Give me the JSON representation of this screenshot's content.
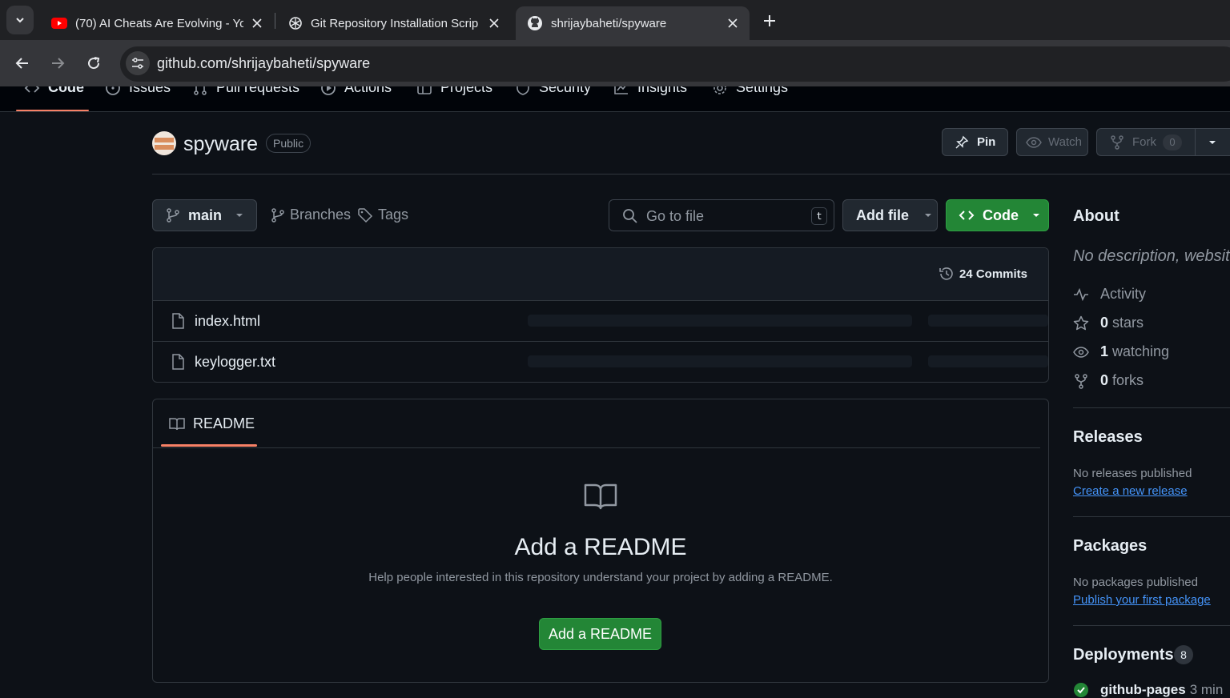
{
  "browser": {
    "tabs": [
      {
        "title": "(70) AI Cheats Are Evolving - Yo",
        "icon": "youtube-icon",
        "active": false
      },
      {
        "title": "Git Repository Installation Scrip",
        "icon": "chatgpt-icon",
        "active": false
      },
      {
        "title": "shrijaybaheti/spyware",
        "icon": "github-icon",
        "active": true
      }
    ],
    "url": "github.com/shrijaybaheti/spyware"
  },
  "repo_nav": {
    "items": [
      {
        "label": "Code",
        "icon": "code-icon",
        "selected": true
      },
      {
        "label": "Issues",
        "icon": "issue-icon"
      },
      {
        "label": "Pull requests",
        "icon": "pull-request-icon"
      },
      {
        "label": "Actions",
        "icon": "play-icon"
      },
      {
        "label": "Projects",
        "icon": "table-icon"
      },
      {
        "label": "Security",
        "icon": "shield-icon"
      },
      {
        "label": "Insights",
        "icon": "graph-icon"
      },
      {
        "label": "Settings",
        "icon": "gear-icon"
      }
    ]
  },
  "repo": {
    "name": "spyware",
    "visibility": "Public",
    "pin_label": "Pin",
    "watch_label": "Watch",
    "fork_label": "Fork",
    "fork_count": "0"
  },
  "file_nav": {
    "branch": "main",
    "branches_label": "Branches",
    "tags_label": "Tags",
    "search_placeholder": "Go to file",
    "search_shortcut": "t",
    "add_file_label": "Add file",
    "code_label": "Code"
  },
  "files": {
    "commits_label": "24 Commits",
    "rows": [
      {
        "name": "index.html"
      },
      {
        "name": "keylogger.txt"
      }
    ]
  },
  "readme": {
    "tab_label": "README",
    "title": "Add a README",
    "help": "Help people interested in this repository understand your project by adding a README.",
    "button": "Add a README"
  },
  "sidebar": {
    "about_title": "About",
    "description": "No description, website",
    "stats": [
      {
        "icon": "pulse-icon",
        "bold": "",
        "label": "Activity"
      },
      {
        "icon": "star-icon",
        "bold": "0",
        "label": "stars"
      },
      {
        "icon": "eye-icon",
        "bold": "1",
        "label": "watching"
      },
      {
        "icon": "fork-icon",
        "bold": "0",
        "label": "forks"
      }
    ],
    "releases_title": "Releases",
    "releases_text": "No releases published",
    "releases_link": "Create a new release",
    "packages_title": "Packages",
    "packages_text": "No packages published",
    "packages_link": "Publish your first package",
    "deployments_title": "Deployments",
    "deployments_count": "8",
    "deployment_item": "github-pages",
    "deployment_time": "3 min"
  },
  "colors": {
    "accent_underline": "#f78166",
    "primary_green": "#238636",
    "link_blue": "#4493f8",
    "background": "#0d1117"
  }
}
